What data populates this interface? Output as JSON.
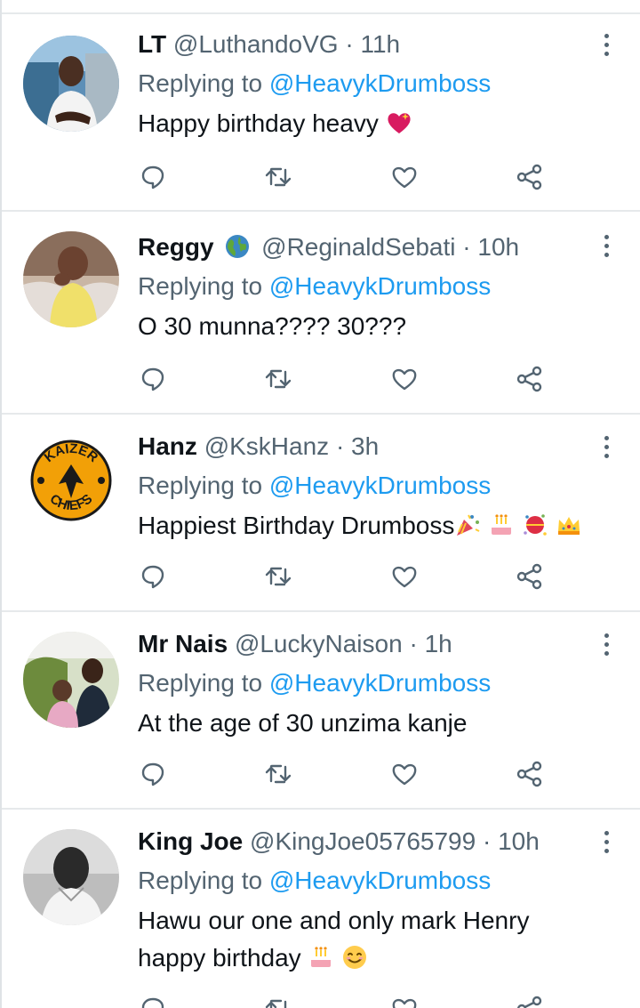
{
  "reply_prefix": "Replying to",
  "tweets": [
    {
      "name": "LT",
      "handle": "@LuthandoVG",
      "separator": "·",
      "time": "11h",
      "reply_to": "@HeavykDrumboss",
      "text": "Happy birthday heavy",
      "emojis": [
        "sparkling-heart"
      ]
    },
    {
      "name": "Reggy",
      "handle": "@ReginaldSebati",
      "separator": "·",
      "time": "10h",
      "reply_to": "@HeavykDrumboss",
      "text": "O 30 munna???? 30???",
      "emojis": []
    },
    {
      "name": "Hanz",
      "handle": "@KskHanz",
      "separator": "·",
      "time": "3h",
      "reply_to": "@HeavykDrumboss",
      "text": "Happiest Birthday Drumboss",
      "emojis": [
        "party-popper",
        "birthday-cake",
        "confetti-ball",
        "crown"
      ]
    },
    {
      "name": "Mr Nais",
      "handle": "@LuckyNaison",
      "separator": "·",
      "time": "1h",
      "reply_to": "@HeavykDrumboss",
      "text": "At the age of 30 unzima kanje",
      "emojis": []
    },
    {
      "name": "King Joe",
      "handle": "@KingJoe05765799",
      "separator": "·",
      "time": "10h",
      "reply_to": "@HeavykDrumboss",
      "text_line1": "Hawu our one and only mark Henry",
      "text_line2": "happy birthday",
      "emojis": [
        "birthday-cake",
        "smiling-face"
      ]
    }
  ],
  "avatar_logo_text": {
    "top": "KAIZER",
    "bottom": "CHIEFS"
  },
  "colors": {
    "link": "#1d9bf0",
    "secondary_text": "#536471",
    "primary_text": "#0f1419",
    "divider": "#e6e9eb"
  },
  "icons": [
    "reply-icon",
    "retweet-icon",
    "like-icon",
    "share-icon",
    "more-icon"
  ]
}
